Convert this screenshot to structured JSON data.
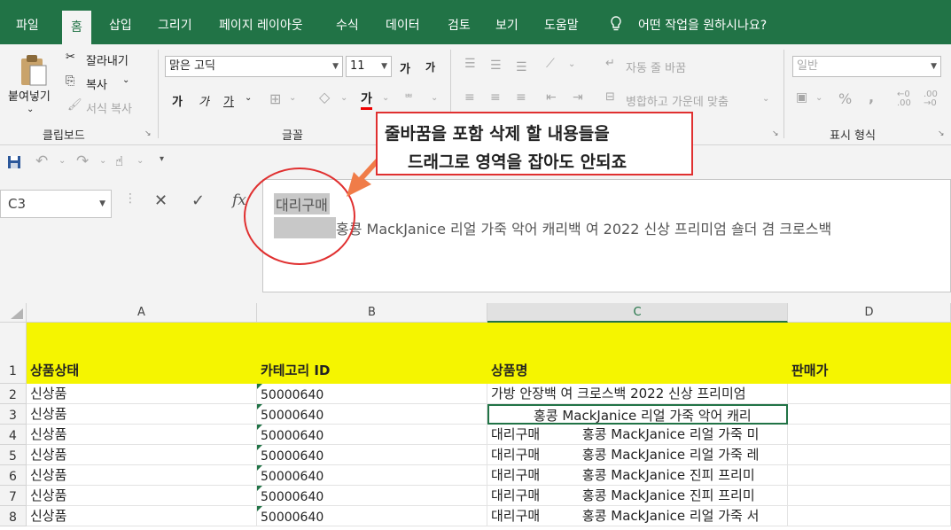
{
  "tabs": [
    "파일",
    "홈",
    "삽입",
    "그리기",
    "페이지 레이아웃",
    "수식",
    "데이터",
    "검토",
    "보기",
    "도움말"
  ],
  "tell_me": "어떤 작업을 원하시나요?",
  "clipboard": {
    "paste": "붙여넣기",
    "cut": "잘라내기",
    "copy": "복사",
    "format_painter": "서식 복사",
    "label": "클립보드"
  },
  "font": {
    "name": "맑은 고딕",
    "size": "11",
    "bold": "가",
    "italic": "가",
    "underline": "가",
    "grow": "가",
    "shrink": "가",
    "color_letter": "가",
    "label": "글꼴"
  },
  "alignment": {
    "wrap": "자동 줄 바꿈",
    "merge": "병합하고 가운데 맞춤"
  },
  "number": {
    "format": "일반",
    "label": "표시 형식",
    "percent": "%",
    "comma": ","
  },
  "name_box": "C3",
  "formula": {
    "line1": "대리구매",
    "line2": "홍콩 MackJanice 리얼 가죽 악어 캐리백 여 2022 신상 프리미엄 숄더 겸 크로스백"
  },
  "columns": [
    "A",
    "B",
    "C",
    "D"
  ],
  "header_row": {
    "num": "1",
    "a": "상품상태",
    "b": "카테고리 ID",
    "c": "상품명",
    "d": "판매가"
  },
  "rows": [
    {
      "num": "2",
      "a": "신상품",
      "b": "50000640",
      "c": "가방 안장백 여 크로스백 2022 신상 프리미엄"
    },
    {
      "num": "3",
      "a": "신상품",
      "b": "50000640",
      "c": "홍콩 MackJanice 리얼 가죽 악어 캐리"
    },
    {
      "num": "4",
      "a": "신상품",
      "b": "50000640",
      "c": "대리구매          홍콩 MackJanice 리얼 가죽 미"
    },
    {
      "num": "5",
      "a": "신상품",
      "b": "50000640",
      "c": "대리구매          홍콩 MackJanice 리얼 가죽 레"
    },
    {
      "num": "6",
      "a": "신상품",
      "b": "50000640",
      "c": "대리구매          홍콩 MackJanice 진피 프리미"
    },
    {
      "num": "7",
      "a": "신상품",
      "b": "50000640",
      "c": "대리구매          홍콩 MackJanice 진피 프리미"
    },
    {
      "num": "8",
      "a": "신상품",
      "b": "50000640",
      "c": "대리구매          홍콩 MackJanice 리얼 가죽 서"
    }
  ],
  "callout": {
    "line1": "줄바꿈을 포함 삭제 할 내용들을",
    "line2": "드래그로 영역을 잡아도 안되죠"
  },
  "colors": {
    "excel_green": "#217346",
    "highlight_yellow": "#f5f500",
    "annotation_red": "#e03030"
  }
}
